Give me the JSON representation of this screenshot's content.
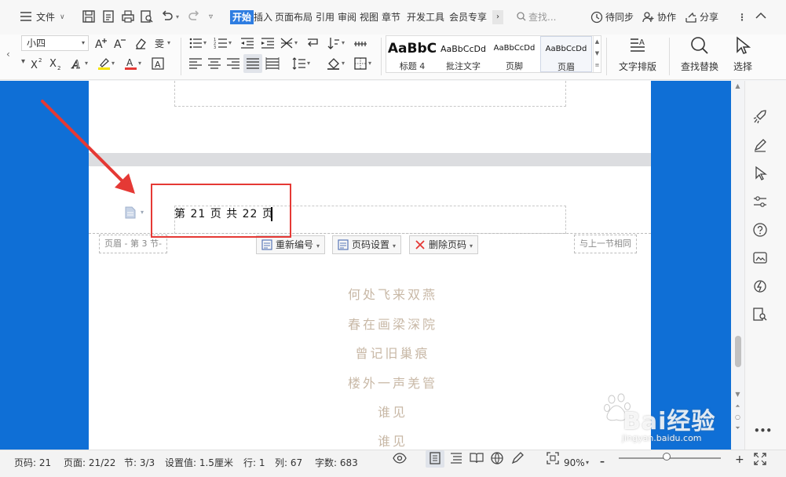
{
  "menubar": {
    "file_label": "文件",
    "tabs": [
      "开始",
      "插入",
      "页面布局",
      "引用",
      "审阅",
      "视图",
      "章节",
      "开发工具",
      "会员专享"
    ],
    "search_placeholder": "查找...",
    "sync_label": "待同步",
    "collab_label": "协作",
    "share_label": "分享"
  },
  "ribbon": {
    "font_size": "小四",
    "styles": [
      {
        "preview": "AaBbC",
        "name": "标题 4"
      },
      {
        "preview": "AaBbCcDd",
        "name": "批注文字"
      },
      {
        "preview": "AaBbCcDd",
        "name": "页脚"
      },
      {
        "preview": "AaBbCcDd",
        "name": "页眉"
      }
    ],
    "text_layout_label": "文字排版",
    "find_replace_label": "查找替换",
    "select_label": "选择"
  },
  "document": {
    "header_text": "第 21 页 共 22 页",
    "header_tag": "页眉 - 第 3 节-",
    "same_as_previous": "与上一节相同",
    "renumber_label": "重新编号",
    "page_settings_label": "页码设置",
    "delete_page_number_label": "删除页码",
    "poem_lines": [
      "何处飞来双燕",
      "春在画梁深院",
      "曾记旧巢痕",
      "楼外一声羌管",
      "谁见",
      "谁见"
    ]
  },
  "statusbar": {
    "page_number": "页码: 21",
    "pages": "页面: 21/22",
    "section": "节: 3/3",
    "setting": "设置值: 1.5厘米",
    "row": "行: 1",
    "column": "列: 67",
    "word_count": "字数: 683",
    "zoom": "90%"
  },
  "watermark": {
    "main": "Bai经验",
    "sub": "jingyan.baidu.com"
  },
  "colors": {
    "accent_blue": "#2e7de1",
    "desktop_blue": "#0f6fd6",
    "highlight_red": "#e53935",
    "poem_color": "#c8b8a6"
  }
}
